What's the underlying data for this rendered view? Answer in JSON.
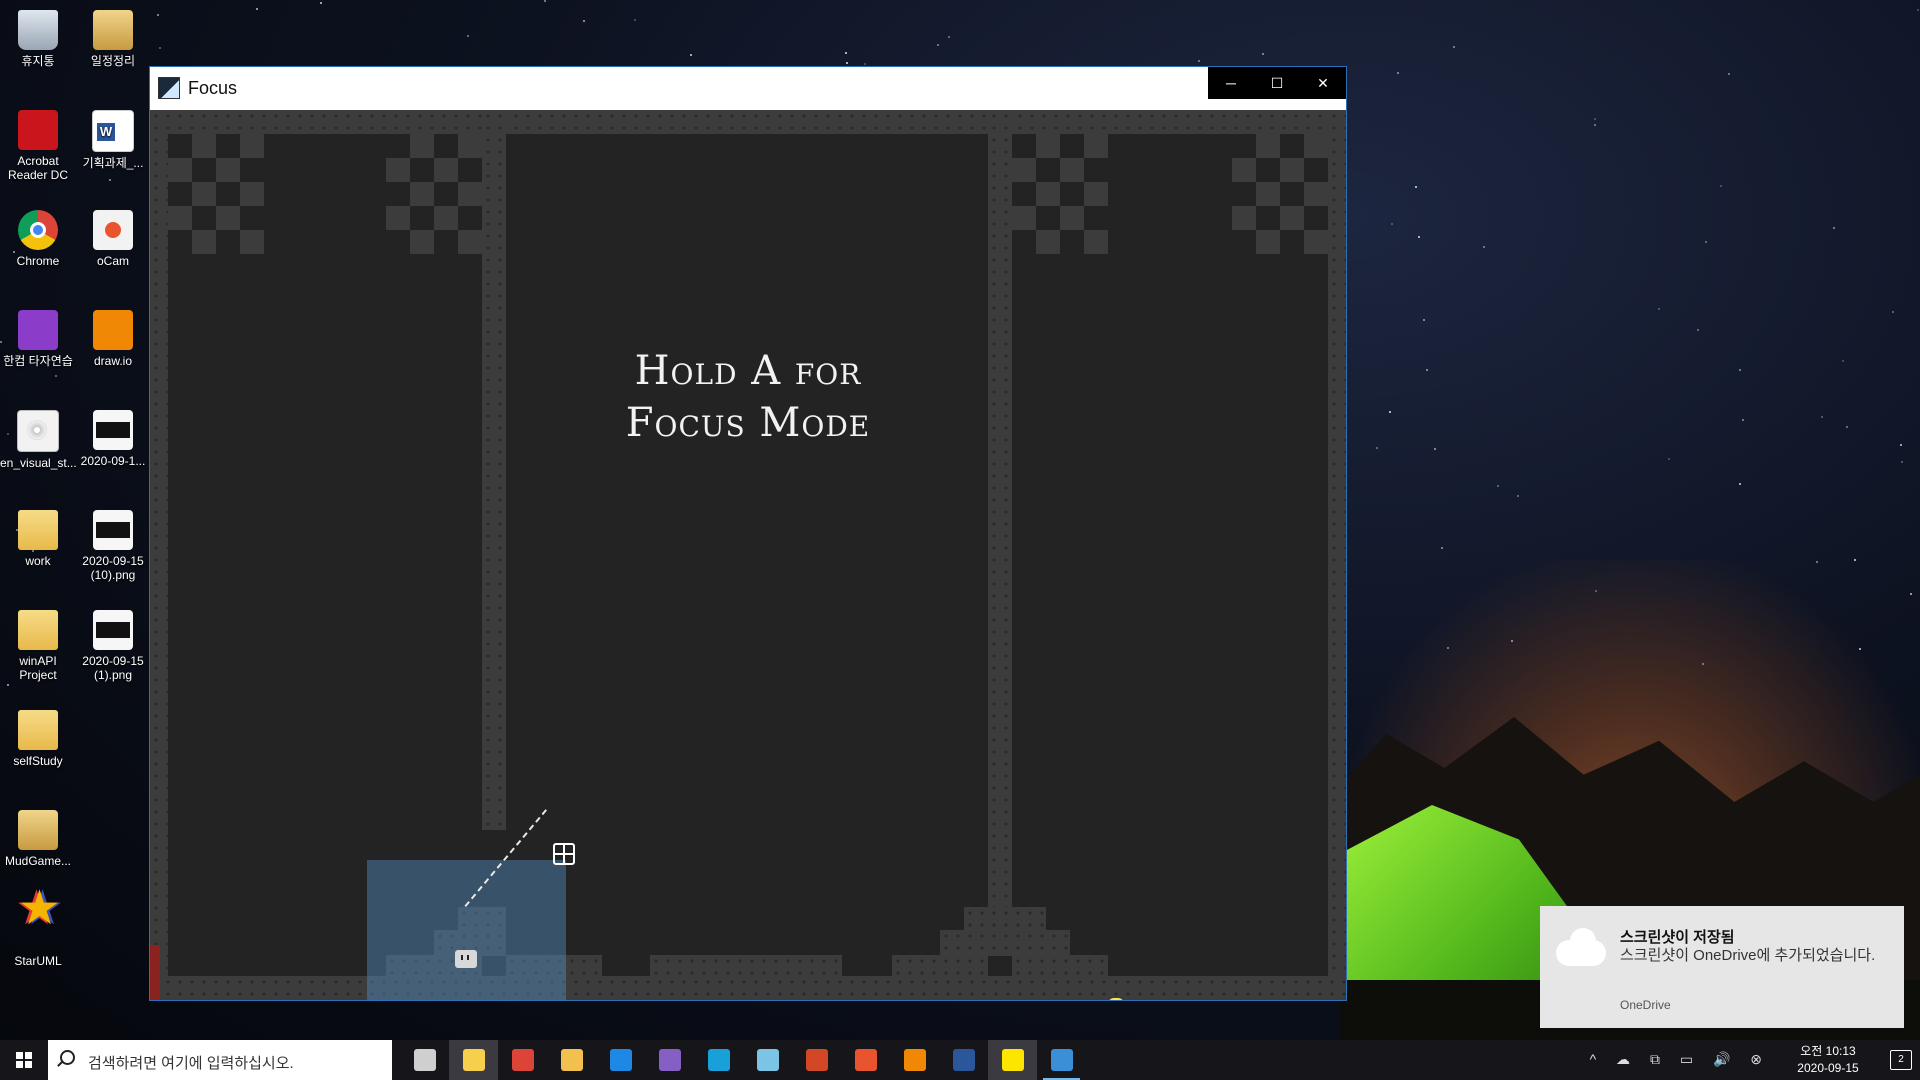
{
  "desktop": {
    "icons": [
      {
        "label": "휴지통",
        "icon": "recycle-bin-icon"
      },
      {
        "label": "일정정리",
        "icon": "folder-image-icon"
      },
      {
        "label": "Acrobat Reader DC",
        "icon": "pdf-icon"
      },
      {
        "label": "기획과제_...",
        "icon": "word-document-icon"
      },
      {
        "label": "Chrome",
        "icon": "chrome-icon"
      },
      {
        "label": "oCam",
        "icon": "ocam-icon"
      },
      {
        "label": "한컴 타자연습",
        "icon": "hancom-typing-icon"
      },
      {
        "label": "draw.io",
        "icon": "drawio-icon"
      },
      {
        "label": "en_visual_st...",
        "icon": "disc-image-icon"
      },
      {
        "label": "2020-09-1...",
        "icon": "image-file-icon"
      },
      {
        "label": "work",
        "icon": "folder-icon"
      },
      {
        "label": "2020-09-15 (10).png",
        "icon": "image-file-icon"
      },
      {
        "label": "winAPI Project",
        "icon": "folder-icon"
      },
      {
        "label": "2020-09-15 (1).png",
        "icon": "image-file-icon"
      },
      {
        "label": "selfStudy",
        "icon": "folder-icon"
      },
      {
        "label": "MudGame...",
        "icon": "folder-image-icon"
      },
      {
        "label": "StarUML",
        "icon": "staruml-icon"
      }
    ]
  },
  "window": {
    "title": "Focus",
    "buttons": {
      "minimize": "─",
      "maximize": "☐",
      "close": "✕"
    }
  },
  "game": {
    "hint_line1": "Hold A for",
    "hint_line2": "Focus Mode",
    "colors": {
      "wall": "#3c3c3c",
      "background": "#232323",
      "coin": "#ffe34d",
      "focus_zone": "#508cbe",
      "lava": "#8a2320"
    }
  },
  "notification": {
    "title": "스크린샷이 저장됨",
    "message": "스크린샷이 OneDrive에 추가되었습니다.",
    "source": "OneDrive"
  },
  "taskbar": {
    "search_placeholder": "검색하려면 여기에 입력하십시오.",
    "apps": [
      {
        "name": "task-view",
        "color": "#cfcfcf"
      },
      {
        "name": "sticky-notes",
        "color": "#f7d04b",
        "active": true
      },
      {
        "name": "chrome",
        "color": "#db4437"
      },
      {
        "name": "file-explorer",
        "color": "#f1c04f"
      },
      {
        "name": "maps",
        "color": "#1e88e5"
      },
      {
        "name": "visual-studio",
        "color": "#865fc5"
      },
      {
        "name": "edge",
        "color": "#1aa0d8"
      },
      {
        "name": "snip",
        "color": "#7cc4e6"
      },
      {
        "name": "powerpoint",
        "color": "#d24726"
      },
      {
        "name": "ocam",
        "color": "#e9532e"
      },
      {
        "name": "drawio",
        "color": "#f08705"
      },
      {
        "name": "word",
        "color": "#2b579a"
      },
      {
        "name": "kakaotalk",
        "color": "#fee500",
        "active": true
      },
      {
        "name": "focus-game",
        "color": "#3a8fd6",
        "run": true
      }
    ],
    "tray_icons": "^ ☁ ⧉ ▭ 🔊 ⊗",
    "clock_time": "오전 10:13",
    "clock_date": "2020-09-15",
    "notification_count": "2"
  }
}
